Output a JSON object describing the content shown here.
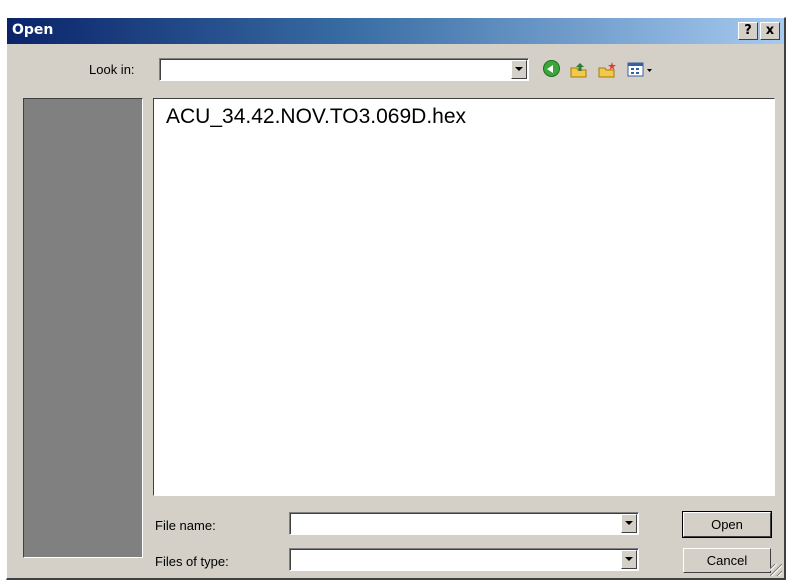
{
  "window": {
    "title": "Open",
    "help_label": "?",
    "close_label": "x"
  },
  "lookin": {
    "label": "Look in:",
    "value": ""
  },
  "toolbar": {
    "icons": [
      "back-icon",
      "up-folder-icon",
      "new-folder-icon",
      "view-menu-icon"
    ]
  },
  "files": [
    {
      "name": "ACU_34.42.NOV.TO3.069D.hex"
    }
  ],
  "filename": {
    "label": "File name:",
    "value": ""
  },
  "filetype": {
    "label": "Files of type:",
    "value": ""
  },
  "buttons": {
    "open": "Open",
    "cancel": "Cancel"
  }
}
